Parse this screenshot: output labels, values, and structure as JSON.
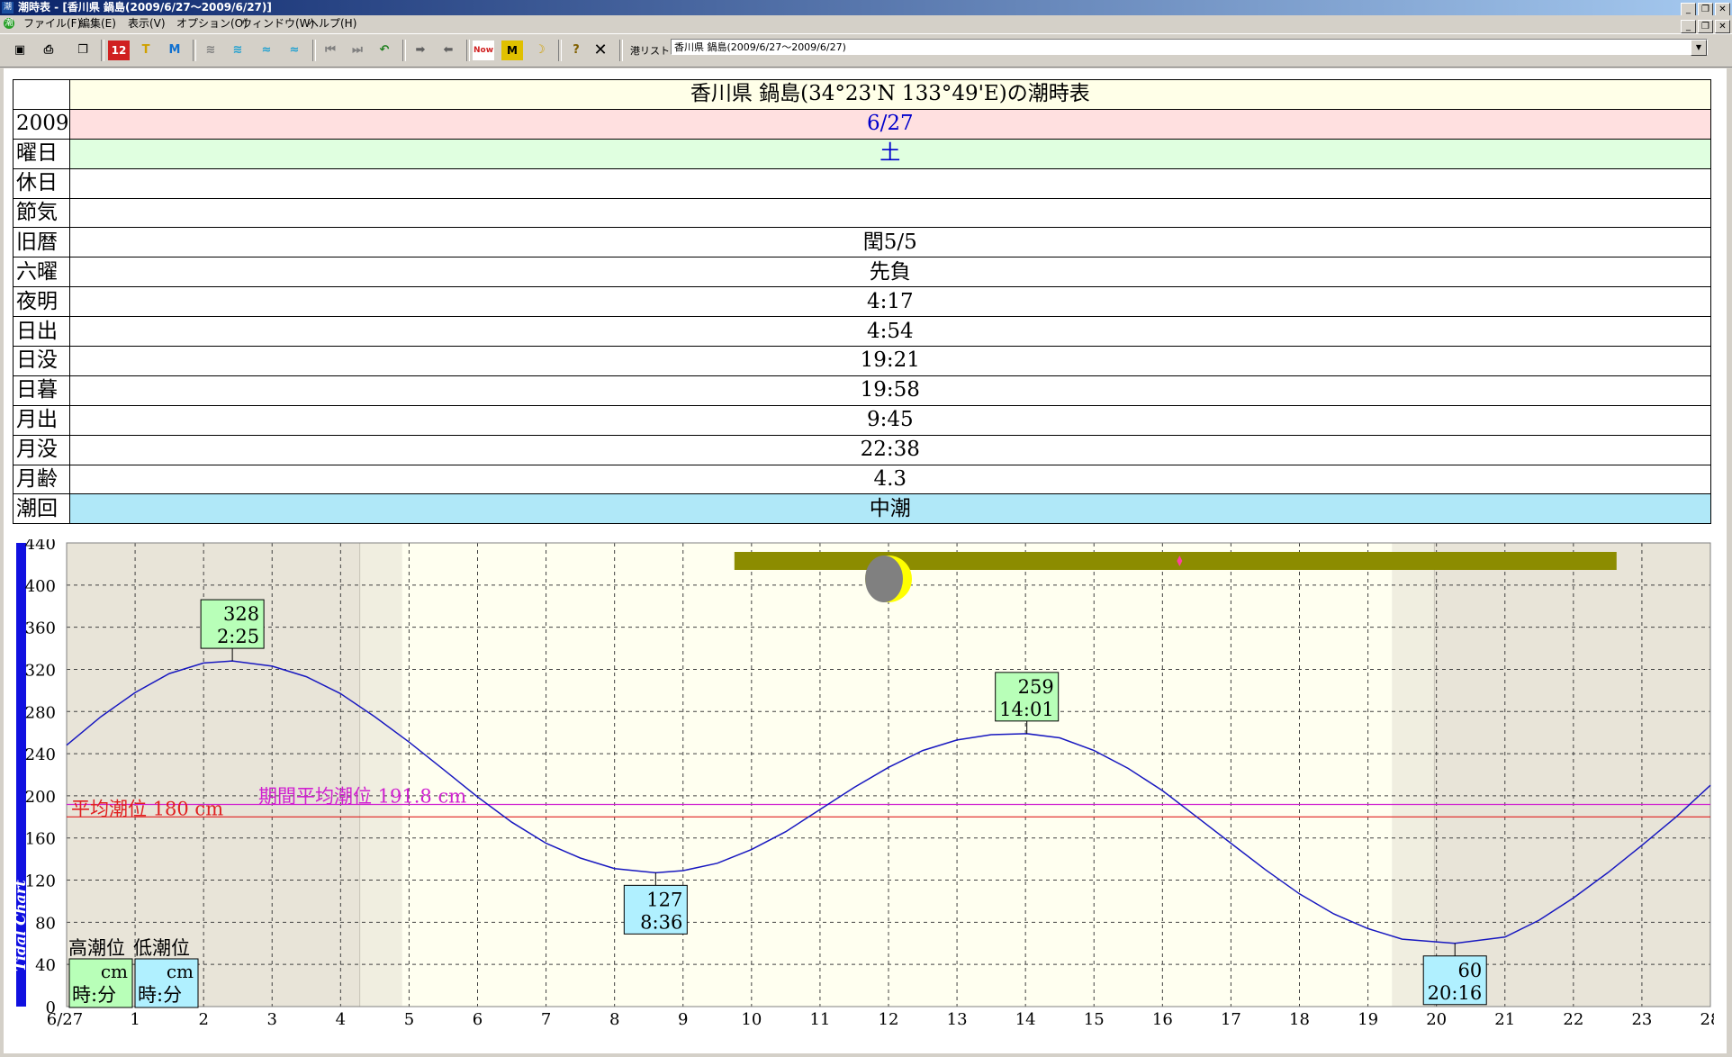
{
  "window": {
    "title": "潮時表 - [香川県 鍋島(2009/6/27～2009/6/27)]",
    "app_icon": "潮"
  },
  "menu": {
    "items": [
      "ファイル(F)",
      "編集(E)",
      "表示(V)",
      "オプション(O)",
      "ウィンドウ(W)",
      "ヘルプ(H)"
    ]
  },
  "toolbar": {
    "port_label": "港リスト:",
    "port_value": "香川県 鍋島(2009/6/27～2009/6/27)"
  },
  "info_table": {
    "title": "香川県 鍋島(34°23'N 133°49'E)の潮時表",
    "rows": [
      {
        "label": "2009",
        "value": "6/27",
        "bg": "#ffe0e0",
        "color": "#0000cc"
      },
      {
        "label": "曜日",
        "value": "土",
        "bg": "#e0ffe0",
        "color": "#0000cc"
      },
      {
        "label": "休日",
        "value": "",
        "bg": "#ffffff",
        "color": "#000000"
      },
      {
        "label": "節気",
        "value": "",
        "bg": "#ffffff",
        "color": "#000000"
      },
      {
        "label": "旧暦",
        "value": "閏5/5",
        "bg": "#ffffff",
        "color": "#000000"
      },
      {
        "label": "六曜",
        "value": "先負",
        "bg": "#ffffff",
        "color": "#000000"
      },
      {
        "label": "夜明",
        "value": "4:17",
        "bg": "#ffffff",
        "color": "#000000"
      },
      {
        "label": "日出",
        "value": "4:54",
        "bg": "#ffffff",
        "color": "#000000"
      },
      {
        "label": "日没",
        "value": "19:21",
        "bg": "#ffffff",
        "color": "#000000"
      },
      {
        "label": "日暮",
        "value": "19:58",
        "bg": "#ffffff",
        "color": "#000000"
      },
      {
        "label": "月出",
        "value": "9:45",
        "bg": "#ffffff",
        "color": "#000000"
      },
      {
        "label": "月没",
        "value": "22:38",
        "bg": "#ffffff",
        "color": "#000000"
      },
      {
        "label": "月齢",
        "value": "4.3",
        "bg": "#ffffff",
        "color": "#000000"
      },
      {
        "label": "潮回",
        "value": "中潮",
        "bg": "#b0e8f8",
        "color": "#000000"
      }
    ]
  },
  "chart_data": {
    "type": "line",
    "ylabel": "Tidal Chart",
    "ylim": [
      0,
      440
    ],
    "yticks": [
      0,
      40,
      80,
      120,
      160,
      200,
      240,
      280,
      320,
      360,
      400,
      440
    ],
    "xlim": [
      0,
      24
    ],
    "xtick_labels": [
      "6/27",
      "1",
      "2",
      "3",
      "4",
      "5",
      "6",
      "7",
      "8",
      "9",
      "10",
      "11",
      "12",
      "13",
      "14",
      "15",
      "16",
      "17",
      "18",
      "19",
      "20",
      "21",
      "22",
      "23",
      "28"
    ],
    "series": [
      {
        "points": [
          [
            0,
            248
          ],
          [
            0.5,
            275
          ],
          [
            1,
            298
          ],
          [
            1.5,
            316
          ],
          [
            2,
            326
          ],
          [
            2.42,
            328
          ],
          [
            3,
            323
          ],
          [
            3.5,
            313
          ],
          [
            4,
            297
          ],
          [
            4.5,
            275
          ],
          [
            5,
            251
          ],
          [
            5.5,
            225
          ],
          [
            6,
            199
          ],
          [
            6.5,
            175
          ],
          [
            7,
            155
          ],
          [
            7.5,
            141
          ],
          [
            8,
            131
          ],
          [
            8.6,
            127
          ],
          [
            9,
            129
          ],
          [
            9.5,
            136
          ],
          [
            10,
            149
          ],
          [
            10.5,
            166
          ],
          [
            11,
            187
          ],
          [
            11.5,
            208
          ],
          [
            12,
            227
          ],
          [
            12.5,
            243
          ],
          [
            13,
            253
          ],
          [
            13.5,
            258
          ],
          [
            14.02,
            259
          ],
          [
            14.5,
            255
          ],
          [
            15,
            243
          ],
          [
            15.5,
            226
          ],
          [
            16,
            205
          ],
          [
            16.5,
            180
          ],
          [
            17,
            155
          ],
          [
            17.5,
            130
          ],
          [
            18,
            107
          ],
          [
            18.5,
            88
          ],
          [
            19,
            74
          ],
          [
            19.5,
            64
          ],
          [
            20.27,
            60
          ],
          [
            21,
            66
          ],
          [
            21.5,
            82
          ],
          [
            22,
            103
          ],
          [
            22.5,
            127
          ],
          [
            23,
            153
          ],
          [
            23.5,
            180
          ],
          [
            24,
            210
          ]
        ]
      }
    ],
    "extremes": [
      {
        "type": "high",
        "time": "2:25",
        "x": 2.42,
        "level": "328"
      },
      {
        "type": "low",
        "time": "8:36",
        "x": 8.6,
        "level": "127"
      },
      {
        "type": "high",
        "time": "14:01",
        "x": 14.02,
        "level": "259"
      },
      {
        "type": "low",
        "time": "20:16",
        "x": 20.27,
        "level": "60"
      }
    ],
    "mean_level": {
      "value": 180,
      "label": "平均潮位 180 cm",
      "color": "#e02020"
    },
    "period_mean": {
      "value": 191.8,
      "label": "期間平均潮位 191.8 cm",
      "color": "#d020d0"
    },
    "dawn": 4.28,
    "sunrise": 4.9,
    "sunset": 19.35,
    "dusk": 19.97,
    "moonrise": 9.75,
    "moonset": 22.63,
    "moon_transit": 16.25,
    "moon_age": "4.3",
    "legend": {
      "high_title": "高潮位",
      "low_title": "低潮位",
      "unit": "cm",
      "time_fmt": "時:分"
    },
    "colors": {
      "tide": "#1818c0",
      "night": "#e8e4d8",
      "day": "#fffff0",
      "high_box": "#b8ffb8",
      "low_box": "#b0f0ff",
      "moonbar": "#8c8c00",
      "moon_lit": "#ffff00",
      "moon_dark": "#808080",
      "axis_bar": "#1010e0"
    }
  }
}
